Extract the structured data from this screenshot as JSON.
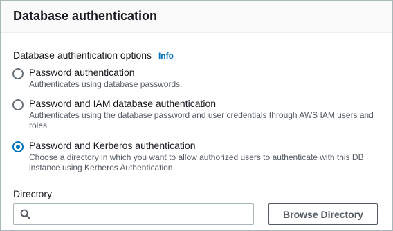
{
  "panel": {
    "title": "Database authentication"
  },
  "auth_options": {
    "label": "Database authentication options",
    "info_link": "Info",
    "options": [
      {
        "label": "Password authentication",
        "description": "Authenticates using database passwords.",
        "selected": false
      },
      {
        "label": "Password and IAM database authentication",
        "description": "Authenticates using the database password and user credentials through AWS IAM users and roles.",
        "selected": false
      },
      {
        "label": "Password and Kerberos authentication",
        "description": "Choose a directory in which you want to allow authorized users to authenticate with this DB instance using Kerberos Authentication.",
        "selected": true
      }
    ]
  },
  "directory": {
    "label": "Directory",
    "search_value": "",
    "search_icon": "search-icon",
    "browse_button": "Browse Directory"
  },
  "colors": {
    "accent": "#0073bb",
    "border": "#aab7b8",
    "text": "#16191f",
    "secondary_text": "#545b64"
  }
}
